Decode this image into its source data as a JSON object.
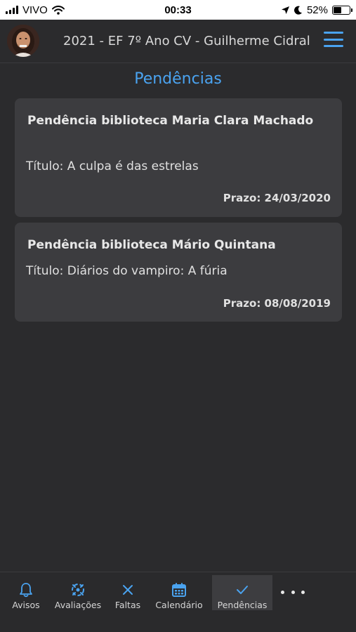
{
  "status_bar": {
    "carrier": "VIVO",
    "time": "00:33",
    "battery": "52%",
    "battery_level": 0.52
  },
  "header": {
    "title": "2021 - EF 7º Ano CV - Guilherme Cidral",
    "avatar_icon": "user-avatar",
    "menu_icon": "hamburger-menu-icon"
  },
  "page": {
    "title": "Pendências"
  },
  "items": [
    {
      "title": "Pendência biblioteca Maria Clara Machado",
      "body": "Título: A culpa é das estrelas",
      "deadline": "Prazo: 24/03/2020"
    },
    {
      "title": "Pendência biblioteca Mário Quintana",
      "body": "Título: Diários do vampiro: A fúria",
      "deadline": "Prazo: 08/08/2019"
    }
  ],
  "tabs": [
    {
      "label": "Avisos",
      "icon": "bell-icon"
    },
    {
      "label": "Avaliações",
      "icon": "evaluations-icon"
    },
    {
      "label": "Faltas",
      "icon": "x-icon"
    },
    {
      "label": "Calendário",
      "icon": "calendar-icon"
    },
    {
      "label": "Pendências",
      "icon": "check-icon",
      "active": true
    }
  ],
  "more_icon": "more-dots-icon",
  "colors": {
    "accent": "#4aa3f0",
    "background": "#2b2b2d",
    "card": "#3c3c3f",
    "active_tab": "#3d3d40"
  }
}
